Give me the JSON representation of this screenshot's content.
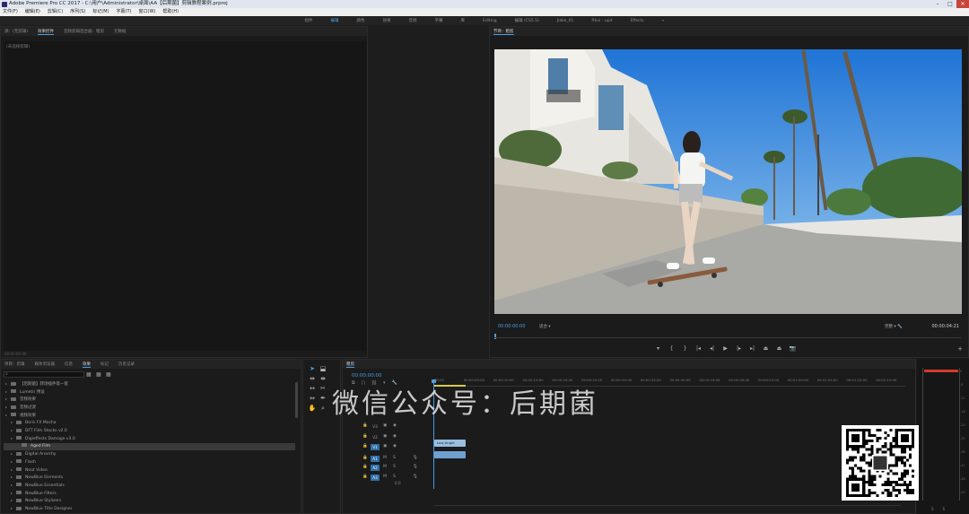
{
  "window": {
    "title": "Adobe Premiere Pro CC 2017 - C:\\用户\\Administrator\\桌面\\AA【后期菌】剪辑教程案例.prproj"
  },
  "menu": [
    "文件(F)",
    "编辑(E)",
    "剪辑(C)",
    "序列(S)",
    "标记(M)",
    "字幕(T)",
    "窗口(W)",
    "帮助(H)"
  ],
  "workspaces": {
    "items": [
      "组件",
      "编辑",
      "颜色",
      "效果",
      "音频",
      "字幕",
      "库",
      "Editing",
      "编辑 (CS5.5)",
      "Jiake_01",
      "Rhui - upd",
      "Effects"
    ],
    "active_index": 1,
    "overflow": "»"
  },
  "source_panel": {
    "tabs": [
      "源：(无剪辑)",
      "效果控件",
      "音频剪辑混合器：粗剪",
      "元数据"
    ],
    "active_index": 1,
    "note": "(未选择剪辑)",
    "status": "00:00:00:00"
  },
  "program_panel": {
    "title": "节目：粗剪",
    "timecode_current": "00:00:00:00",
    "fit": "适合",
    "quality": "完整",
    "timecode_duration": "00:00:04:21",
    "transport": [
      "mark-in",
      "mark-out",
      "go-to-in",
      "step-back",
      "play",
      "step-forward",
      "go-to-out",
      "insert",
      "overwrite",
      "export-frame"
    ]
  },
  "project_panel": {
    "tabs": [
      "项目：剪辑",
      "媒体浏览器",
      "信息",
      "效果",
      "标记",
      "历史记录"
    ],
    "active_index": 3,
    "tree": [
      {
        "label": "【后期菌】转场插件第一套",
        "indent": 0
      },
      {
        "label": "Lumetri 预设",
        "indent": 0
      },
      {
        "label": "音频效果",
        "indent": 0
      },
      {
        "label": "音频过渡",
        "indent": 0
      },
      {
        "label": "视频效果",
        "indent": 0
      },
      {
        "label": "Boris FX Mocha",
        "indent": 1
      },
      {
        "label": "DFT Film Stocks v2.0",
        "indent": 1
      },
      {
        "label": "Digieffects Damage v3.0",
        "indent": 1
      },
      {
        "label": "Aged Film",
        "indent": 2,
        "selected": true
      },
      {
        "label": "Digital Anarchy",
        "indent": 1
      },
      {
        "label": "Flash",
        "indent": 1
      },
      {
        "label": "Neat Video",
        "indent": 1
      },
      {
        "label": "NewBlue Elements",
        "indent": 1
      },
      {
        "label": "NewBlue Essentials",
        "indent": 1
      },
      {
        "label": "NewBlue Filters",
        "indent": 1
      },
      {
        "label": "NewBlue Stylizers",
        "indent": 1
      },
      {
        "label": "NewBlue Title Designer",
        "indent": 1
      },
      {
        "label": "Obsolete",
        "indent": 1
      }
    ]
  },
  "timeline": {
    "title": "粗剪",
    "timecode": "00:00:00:00",
    "ruler": [
      "00:00",
      "00:00:05:00",
      "00:00:10:00",
      "00:00:15:00",
      "00:00:20:00",
      "00:00:25:00",
      "00:00:30:00",
      "00:00:35:00",
      "00:00:40:00",
      "00:00:45:00",
      "00:00:50:00",
      "00:00:55:00",
      "00:01:00:00",
      "00:01:05:00",
      "00:01:10:00",
      "00:01:15:00"
    ],
    "tracks": [
      "V3",
      "V2",
      "V1",
      "A1",
      "A2",
      "A3"
    ],
    "master_value": "0.0",
    "clips": {
      "video": "Low Angle",
      "audio": ""
    }
  },
  "meter": {
    "labels": [
      "S",
      "S"
    ],
    "scale": [
      "0",
      "-6",
      "-12",
      "-18",
      "-24",
      "-30",
      "-36",
      "-42",
      "-48",
      "-54"
    ]
  },
  "overlay": {
    "watermark": "微信公众号：后期菌"
  }
}
